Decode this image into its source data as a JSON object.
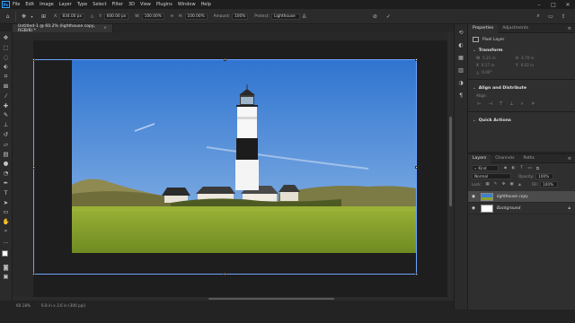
{
  "app": {
    "logo": "Ps"
  },
  "menu": {
    "items": [
      "File",
      "Edit",
      "Image",
      "Layer",
      "Type",
      "Select",
      "Filter",
      "3D",
      "View",
      "Plugins",
      "Window",
      "Help"
    ]
  },
  "options": {
    "x_label": "X:",
    "x_value": "834.00 px",
    "y_label": "Y:",
    "y_value": "600.00 px",
    "w_label": "W:",
    "w_value": "100.00%",
    "h_label": "H:",
    "h_value": "100.00%",
    "angle_label": "⊿",
    "angle_value": "0.00",
    "h_skew_label": "H:",
    "h_skew_value": "0.00",
    "v_skew_label": "V:",
    "v_skew_value": "0.00",
    "interp_label": "Amount:",
    "interp_value": "100%",
    "protect_label": "Protect:",
    "protect_value": "Lighthouse"
  },
  "document": {
    "tab_title": "Untitled-1 @ 60.2% (lighthouse copy, RGB/8) *",
    "tab_close": "×"
  },
  "status": {
    "zoom": "60.18%",
    "info": "6.8 in x 3.6 in (300 ppi)"
  },
  "properties": {
    "tabs": [
      "Properties",
      "Adjustments"
    ],
    "layer_type": "Pixel Layer",
    "transform_title": "Transform",
    "w_value": "5.21 in",
    "h_value": "4.70 in",
    "x_value": "0.17 in",
    "y_value": "0.02 in",
    "angle_value": "0.00°",
    "align_title": "Align and Distribute",
    "align_label": "Align:",
    "quick_title": "Quick Actions"
  },
  "layers_panel": {
    "tabs": [
      "Layers",
      "Channels",
      "Paths"
    ],
    "filter_label": "Kind",
    "blend_mode": "Normal",
    "opacity_label": "Opacity:",
    "opacity_value": "100%",
    "lock_label": "Lock:",
    "fill_label": "Fill:",
    "fill_value": "100%",
    "layers": [
      {
        "name": "lighthouse copy",
        "selected": true
      },
      {
        "name": "Background",
        "selected": false
      }
    ]
  },
  "colors": {
    "accent": "#31a8ff",
    "selection": "#6fa3ff",
    "panel": "#2f2f2f",
    "sky": "#4e8ad6",
    "grass": "#8aa32f"
  }
}
